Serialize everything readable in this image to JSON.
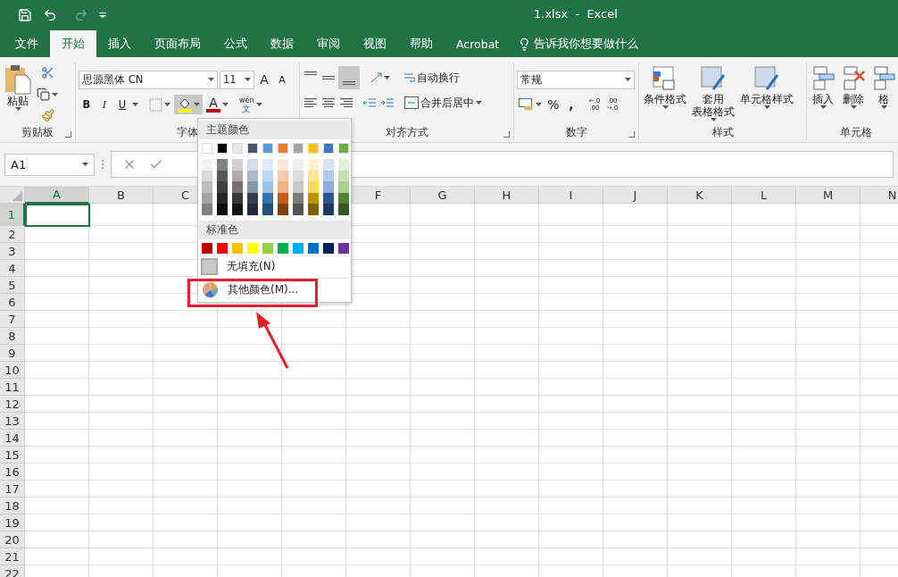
{
  "title_bar": {
    "title": "1.xlsx  -  Excel"
  },
  "tabs": [
    {
      "label": "文件",
      "selected": false
    },
    {
      "label": "开始",
      "selected": true
    },
    {
      "label": "插入",
      "selected": false
    },
    {
      "label": "页面布局",
      "selected": false
    },
    {
      "label": "公式",
      "selected": false
    },
    {
      "label": "数据",
      "selected": false
    },
    {
      "label": "审阅",
      "selected": false
    },
    {
      "label": "视图",
      "selected": false
    },
    {
      "label": "帮助",
      "selected": false
    },
    {
      "label": "Acrobat",
      "selected": false
    }
  ],
  "tell_me": "告诉我你想要做什么",
  "ribbon": {
    "clipboard": {
      "paste": "粘贴",
      "label": "剪贴板"
    },
    "font": {
      "font_name": "思源黑体 CN",
      "font_size": "11",
      "grow": "A",
      "shrink": "A",
      "bold": "B",
      "italic": "I",
      "underline": "U",
      "fill_pressed": true,
      "font_color": "A",
      "phonetic_top": "wén",
      "phonetic_bottom": "文",
      "label": "字体"
    },
    "alignment": {
      "bottom_align_selected": true,
      "wrap": "自动换行",
      "merge": "合并后居中",
      "label": "对齐方式"
    },
    "number": {
      "format": "常规",
      "percent": "%",
      "comma": ",",
      "decimals": [
        {
          "top": "←.0",
          "bottom": ".00"
        },
        {
          "top": ".00",
          "bottom": "→.0"
        }
      ],
      "label": "数字"
    },
    "styles": {
      "buttons": [
        {
          "lines": [
            "条件格式"
          ]
        },
        {
          "lines": [
            "套用",
            "表格格式"
          ]
        },
        {
          "lines": [
            "单元格样式"
          ]
        }
      ],
      "label": "样式"
    },
    "cells": {
      "buttons": [
        "插入",
        "删除",
        "格"
      ],
      "label": "单元格"
    }
  },
  "formula_bar": {
    "name_box": "A1"
  },
  "grid": {
    "columns": [
      {
        "label": "A",
        "selected": true
      },
      {
        "label": "B",
        "selected": false
      },
      {
        "label": "C",
        "selected": false
      },
      {
        "label": "F",
        "selected": false
      },
      {
        "label": "G",
        "selected": false
      },
      {
        "label": "H",
        "selected": false
      },
      {
        "label": "I",
        "selected": false
      },
      {
        "label": "J",
        "selected": false
      },
      {
        "label": "K",
        "selected": false
      },
      {
        "label": "L",
        "selected": false
      },
      {
        "label": "M",
        "selected": false
      },
      {
        "label": "N",
        "selected": false
      }
    ],
    "rows": [
      {
        "label": "1",
        "selected": true
      },
      {
        "label": "2",
        "selected": false
      },
      {
        "label": "3",
        "selected": false
      },
      {
        "label": "4",
        "selected": false
      },
      {
        "label": "5",
        "selected": false
      },
      {
        "label": "6",
        "selected": false
      },
      {
        "label": "7",
        "selected": false
      },
      {
        "label": "8",
        "selected": false
      },
      {
        "label": "9",
        "selected": false
      },
      {
        "label": "10",
        "selected": false
      },
      {
        "label": "11",
        "selected": false
      },
      {
        "label": "12",
        "selected": false
      },
      {
        "label": "13",
        "selected": false
      },
      {
        "label": "14",
        "selected": false
      },
      {
        "label": "15",
        "selected": false
      },
      {
        "label": "16",
        "selected": false
      },
      {
        "label": "17",
        "selected": false
      },
      {
        "label": "18",
        "selected": false
      },
      {
        "label": "19",
        "selected": false
      },
      {
        "label": "20",
        "selected": false
      },
      {
        "label": "21",
        "selected": false
      },
      {
        "label": "22",
        "selected": false
      }
    ]
  },
  "fill_menu": {
    "theme_heading": "主题颜色",
    "theme_colors": [
      {
        "color": "#ffffff",
        "shades": [
          {
            "color": "#f2f2f2"
          },
          {
            "color": "#d9d9d9"
          },
          {
            "color": "#bfbfbf"
          },
          {
            "color": "#a6a6a6"
          },
          {
            "color": "#808080"
          }
        ]
      },
      {
        "color": "#000000",
        "shades": [
          {
            "color": "#808080"
          },
          {
            "color": "#595959"
          },
          {
            "color": "#404040"
          },
          {
            "color": "#262626"
          },
          {
            "color": "#0d0d0d"
          }
        ]
      },
      {
        "color": "#e7e6e6",
        "shades": [
          {
            "color": "#d0cece"
          },
          {
            "color": "#aeaaaa"
          },
          {
            "color": "#757171"
          },
          {
            "color": "#3a3838"
          },
          {
            "color": "#161616"
          }
        ]
      },
      {
        "color": "#44546a",
        "shades": [
          {
            "color": "#d6dce4"
          },
          {
            "color": "#adb9ca"
          },
          {
            "color": "#8497b0"
          },
          {
            "color": "#333f4f"
          },
          {
            "color": "#222a35"
          }
        ]
      },
      {
        "color": "#5b9bd5",
        "shades": [
          {
            "color": "#deebf6"
          },
          {
            "color": "#bdd7ee"
          },
          {
            "color": "#9dc3e6"
          },
          {
            "color": "#2e75b5"
          },
          {
            "color": "#1f4e79"
          }
        ]
      },
      {
        "color": "#ed7d31",
        "shades": [
          {
            "color": "#fbe5d5"
          },
          {
            "color": "#f8cbad"
          },
          {
            "color": "#f4b183"
          },
          {
            "color": "#c55a11"
          },
          {
            "color": "#843c0b"
          }
        ]
      },
      {
        "color": "#a5a5a5",
        "shades": [
          {
            "color": "#ededed"
          },
          {
            "color": "#dbdbdb"
          },
          {
            "color": "#c9c9c9"
          },
          {
            "color": "#7b7b7b"
          },
          {
            "color": "#525252"
          }
        ]
      },
      {
        "color": "#ffc000",
        "shades": [
          {
            "color": "#fff2cc"
          },
          {
            "color": "#fee599"
          },
          {
            "color": "#ffd965"
          },
          {
            "color": "#bf9000"
          },
          {
            "color": "#7f6000"
          }
        ]
      },
      {
        "color": "#4472c4",
        "shades": [
          {
            "color": "#dae3f3"
          },
          {
            "color": "#b4c7e7"
          },
          {
            "color": "#8faadc"
          },
          {
            "color": "#2f5597"
          },
          {
            "color": "#203864"
          }
        ]
      },
      {
        "color": "#70ad47",
        "shades": [
          {
            "color": "#e2f0d9"
          },
          {
            "color": "#c5e0b4"
          },
          {
            "color": "#a9d18e"
          },
          {
            "color": "#538135"
          },
          {
            "color": "#375623"
          }
        ]
      }
    ],
    "standard_heading": "标准色",
    "standard_colors": [
      {
        "color": "#c00000"
      },
      {
        "color": "#ff0000"
      },
      {
        "color": "#ffc000"
      },
      {
        "color": "#ffff00"
      },
      {
        "color": "#92d050"
      },
      {
        "color": "#00b050"
      },
      {
        "color": "#00b0f0"
      },
      {
        "color": "#0070c0"
      },
      {
        "color": "#002060"
      },
      {
        "color": "#7030a0"
      }
    ],
    "no_fill": "无填充(N)",
    "more_colors": "其他颜色(M)..."
  }
}
